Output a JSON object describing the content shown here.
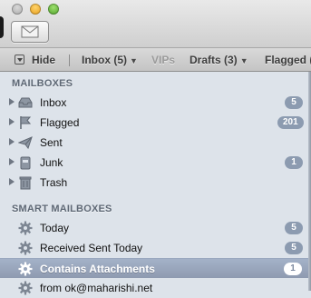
{
  "toolbar": {
    "compose_icon": "envelope-icon"
  },
  "favorites": {
    "hide": "Hide",
    "inbox": "Inbox (5)",
    "vips": "VIPs",
    "drafts": "Drafts (3)",
    "flagged": "Flagged ("
  },
  "sidebar": {
    "mailboxes_header": "MAILBOXES",
    "mailboxes": [
      {
        "label": "Inbox",
        "icon": "inbox-tray-icon",
        "badge": "5"
      },
      {
        "label": "Flagged",
        "icon": "flag-icon",
        "badge": "201"
      },
      {
        "label": "Sent",
        "icon": "paper-plane-icon",
        "badge": ""
      },
      {
        "label": "Junk",
        "icon": "trash-bin-icon",
        "badge": "1"
      },
      {
        "label": "Trash",
        "icon": "trash-can-icon",
        "badge": ""
      }
    ],
    "smart_header": "SMART MAILBOXES",
    "smart": [
      {
        "label": "Today",
        "icon": "gear-icon",
        "badge": "5"
      },
      {
        "label": "Received Sent Today",
        "icon": "gear-icon",
        "badge": "5"
      },
      {
        "label": "Contains Attachments",
        "icon": "gear-icon",
        "badge": "1",
        "selected": true
      },
      {
        "label": "from ok@maharishi.net",
        "icon": "gear-icon",
        "badge": ""
      }
    ]
  },
  "colors": {
    "sidebar_bg": "#dde3ea",
    "badge_bg": "#8c9bb0",
    "selection": "#9aa7bd"
  }
}
